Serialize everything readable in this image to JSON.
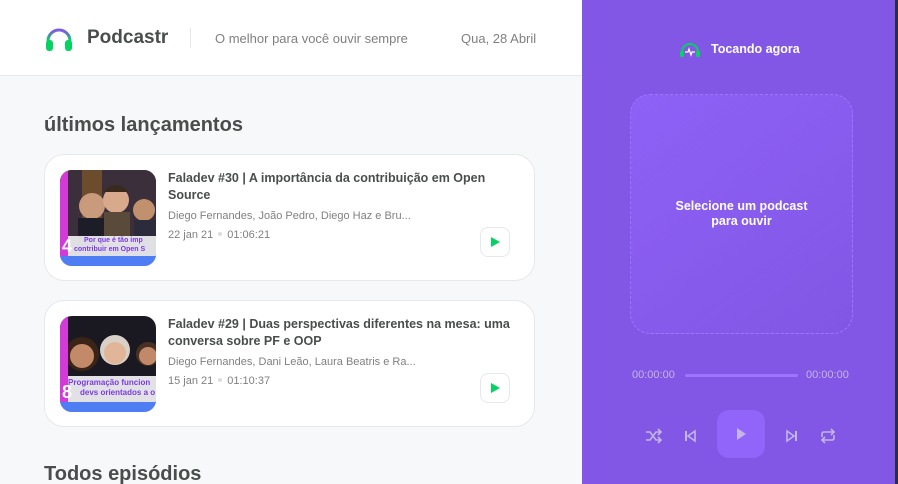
{
  "header": {
    "app_name": "Podcastr",
    "tagline": "O melhor para você ouvir sempre",
    "date": "Qua, 28 Abril",
    "logo_icon": "headphones-icon"
  },
  "latest": {
    "title": "últimos lançamentos",
    "episodes": [
      {
        "title": "Faladev #30 | A importância da contribuição em Open Source",
        "members": "Diego Fernandes, João Pedro, Diego Haz e Bru...",
        "date": "22 jan 21",
        "duration": "01:06:21",
        "thumb_number": "4",
        "thumb_caption_1": "Por que é tão imp",
        "thumb_caption_2": "contribuir em Open S"
      },
      {
        "title": "Faladev #29 | Duas perspectivas diferentes na mesa: uma conversa sobre PF e OOP",
        "members": "Diego Fernandes, Dani Leão, Laura Beatris e Ra...",
        "date": "15 jan 21",
        "duration": "01:10:37",
        "thumb_number": "8",
        "thumb_caption_1": "Programação funcion",
        "thumb_caption_2": "devs orientados a o"
      }
    ]
  },
  "all_episodes": {
    "title": "Todos episódios"
  },
  "player": {
    "heading": "Tocando agora",
    "empty_message": "Selecione um podcast para ouvir",
    "time_current": "00:00:00",
    "time_total": "00:00:00",
    "progress": 0,
    "controls": [
      "shuffle-icon",
      "previous-icon",
      "play-icon",
      "next-icon",
      "repeat-icon"
    ]
  },
  "colors": {
    "accent": "#8257e5",
    "green": "#04d361",
    "text": "#494d4b",
    "muted": "#808080"
  }
}
